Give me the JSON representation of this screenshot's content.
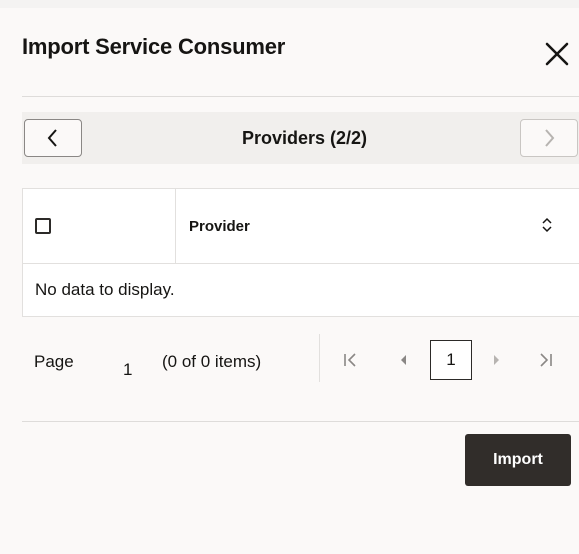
{
  "dialog": {
    "title": "Import Service Consumer",
    "close_icon": "close-icon"
  },
  "train": {
    "label": "Providers (2/2)",
    "prev_icon": "chevron-left-icon",
    "next_icon": "chevron-right-icon"
  },
  "table": {
    "columns": [
      "Provider"
    ],
    "sort_icon": "sort-icon",
    "empty_message": "No data to display."
  },
  "pagination": {
    "page_label": "Page",
    "page_number": "1",
    "items_summary": "(0 of 0 items)",
    "current_page": "1",
    "icons": [
      "first-page-icon",
      "previous-page-icon",
      "next-page-icon",
      "last-page-icon"
    ]
  },
  "footer": {
    "import_label": "Import"
  },
  "colors": {
    "primary_button": "#312d2a",
    "background": "#fbf9f8",
    "border": "#e2e0de"
  }
}
